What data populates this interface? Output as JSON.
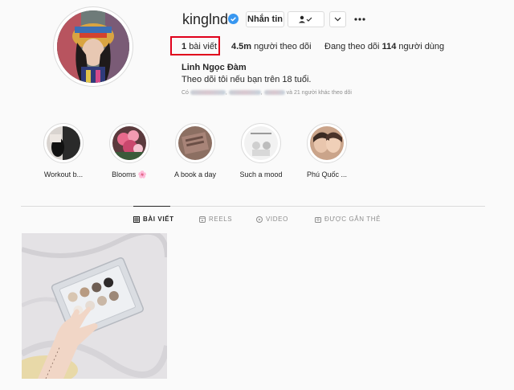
{
  "profile": {
    "username": "kinglnd",
    "full_name": "Linh Ngọc Đàm",
    "bio": "Theo dõi tôi nếu bạn trên 18 tuổi.",
    "followed_by_prefix": "Có",
    "followed_by_suffix": "và 21 người khác theo dõi"
  },
  "actions": {
    "message_label": "Nhắn tin"
  },
  "stats": {
    "posts_count": "1",
    "posts_label": "bài viết",
    "followers_count": "4.5m",
    "followers_label": "người theo dõi",
    "following_prefix": "Đang theo dõi",
    "following_count": "114",
    "following_label": "người dùng"
  },
  "highlights": [
    {
      "label": "Workout b..."
    },
    {
      "label": "Blooms 🌸"
    },
    {
      "label": "A book a day"
    },
    {
      "label": "Such a mood"
    },
    {
      "label": "Phú Quốc ..."
    }
  ],
  "tabs": [
    {
      "label": "BÀI VIẾT",
      "icon": "grid-icon",
      "active": true
    },
    {
      "label": "REELS",
      "icon": "reels-icon",
      "active": false
    },
    {
      "label": "VIDEO",
      "icon": "play-icon",
      "active": false
    },
    {
      "label": "ĐƯỢC GẮN THẺ",
      "icon": "tag-icon",
      "active": false
    }
  ],
  "colors": {
    "highlight_box": "#e0001b",
    "verified_blue": "#3897f0",
    "text": "#262626",
    "muted": "#8e8e8e"
  }
}
